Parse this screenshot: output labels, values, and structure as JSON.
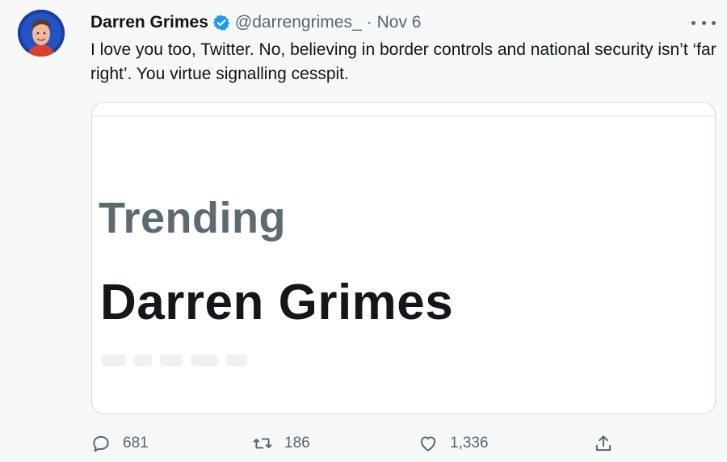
{
  "tweet": {
    "author_name": "Darren Grimes",
    "handle": "@darrengrimes_",
    "separator": "·",
    "date": "Nov 6",
    "text": "I love you too, Twitter. No, believing in border controls and national security isn’t ‘far right’. You virtue signalling cesspit.",
    "card": {
      "label": "Trending",
      "title": "Darren Grimes"
    },
    "actions": {
      "replies": "681",
      "retweets": "186",
      "likes": "1,336"
    }
  },
  "colors": {
    "verified": "#1d9bf0",
    "secondary_text": "#536471",
    "border": "#cfd9de",
    "background": "#f7f9f9"
  },
  "icons": [
    "verified-badge-icon",
    "more-icon",
    "reply-icon",
    "retweet-icon",
    "like-icon",
    "share-icon"
  ]
}
